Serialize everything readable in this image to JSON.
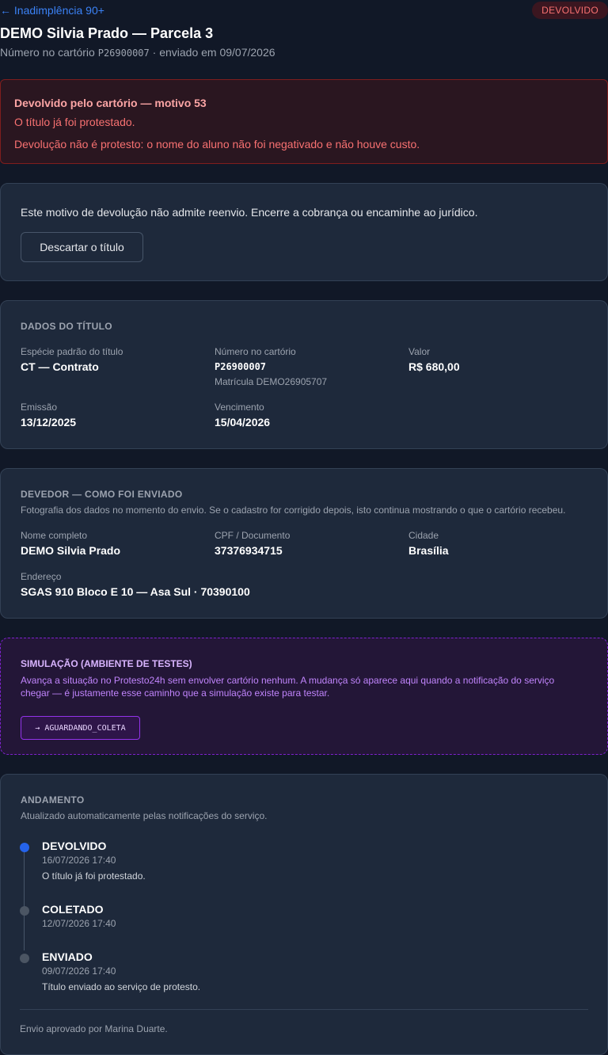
{
  "header": {
    "back_link": "← Inadimplência 90+",
    "status_badge": "DEVOLVIDO",
    "title": "DEMO Silvia Prado — Parcela 3",
    "subtitle_prefix": "Número no cartório",
    "subtitle_number": "P26900007",
    "subtitle_suffix": "· enviado em 09/07/2026"
  },
  "alert": {
    "title": "Devolvido pelo cartório — motivo 53",
    "line1": "O título já foi protestado.",
    "line2": "Devolução não é protesto: o nome do aluno não foi negativado e não houve custo."
  },
  "action_card": {
    "text": "Este motivo de devolução não admite reenvio. Encerre a cobrança ou encaminhe ao jurídico.",
    "discard_button": "Descartar o título"
  },
  "titulo": {
    "section_title": "DADOS DO TÍTULO",
    "especie_label": "Espécie padrão do título",
    "especie_value": "CT — Contrato",
    "numero_label": "Número no cartório",
    "numero_value": "P26900007",
    "matricula": "Matrícula DEMO26905707",
    "valor_label": "Valor",
    "valor_value": "R$ 680,00",
    "emissao_label": "Emissão",
    "emissao_value": "13/12/2025",
    "vencimento_label": "Vencimento",
    "vencimento_value": "15/04/2026"
  },
  "devedor": {
    "section_title": "DEVEDOR — COMO FOI ENVIADO",
    "description": "Fotografia dos dados no momento do envio. Se o cadastro for corrigido depois, isto continua mostrando o que o cartório recebeu.",
    "nome_label": "Nome completo",
    "nome_value": "DEMO Silvia Prado",
    "cpf_label": "CPF / Documento",
    "cpf_value": "37376934715",
    "cidade_label": "Cidade",
    "cidade_value": "Brasília",
    "endereco_label": "Endereço",
    "endereco_value": "SGAS 910 Bloco E 10 — Asa Sul · 70390100"
  },
  "simulacao": {
    "title": "SIMULAÇÃO (AMBIENTE DE TESTES)",
    "description": "Avança a situação no Protesto24h sem envolver cartório nenhum. A mudança só aparece aqui quando a notificação do serviço chegar — é justamente esse caminho que a simulação existe para testar.",
    "button": "→ AGUARDANDO_COLETA"
  },
  "andamento": {
    "section_title": "ANDAMENTO",
    "description": "Atualizado automaticamente pelas notificações do serviço.",
    "events": [
      {
        "status": "DEVOLVIDO",
        "date": "16/07/2026 17:40",
        "note": "O título já foi protestado."
      },
      {
        "status": "COLETADO",
        "date": "12/07/2026 17:40",
        "note": ""
      },
      {
        "status": "ENVIADO",
        "date": "09/07/2026 17:40",
        "note": "Título enviado ao serviço de protesto."
      }
    ],
    "approved_by": "Envio aprovado por Marina Duarte."
  },
  "colors": {
    "background": "#111827",
    "card": "#1e293b",
    "accent_blue": "#2563eb",
    "danger": "#f87171",
    "simulation_purple": "#c084fc"
  }
}
